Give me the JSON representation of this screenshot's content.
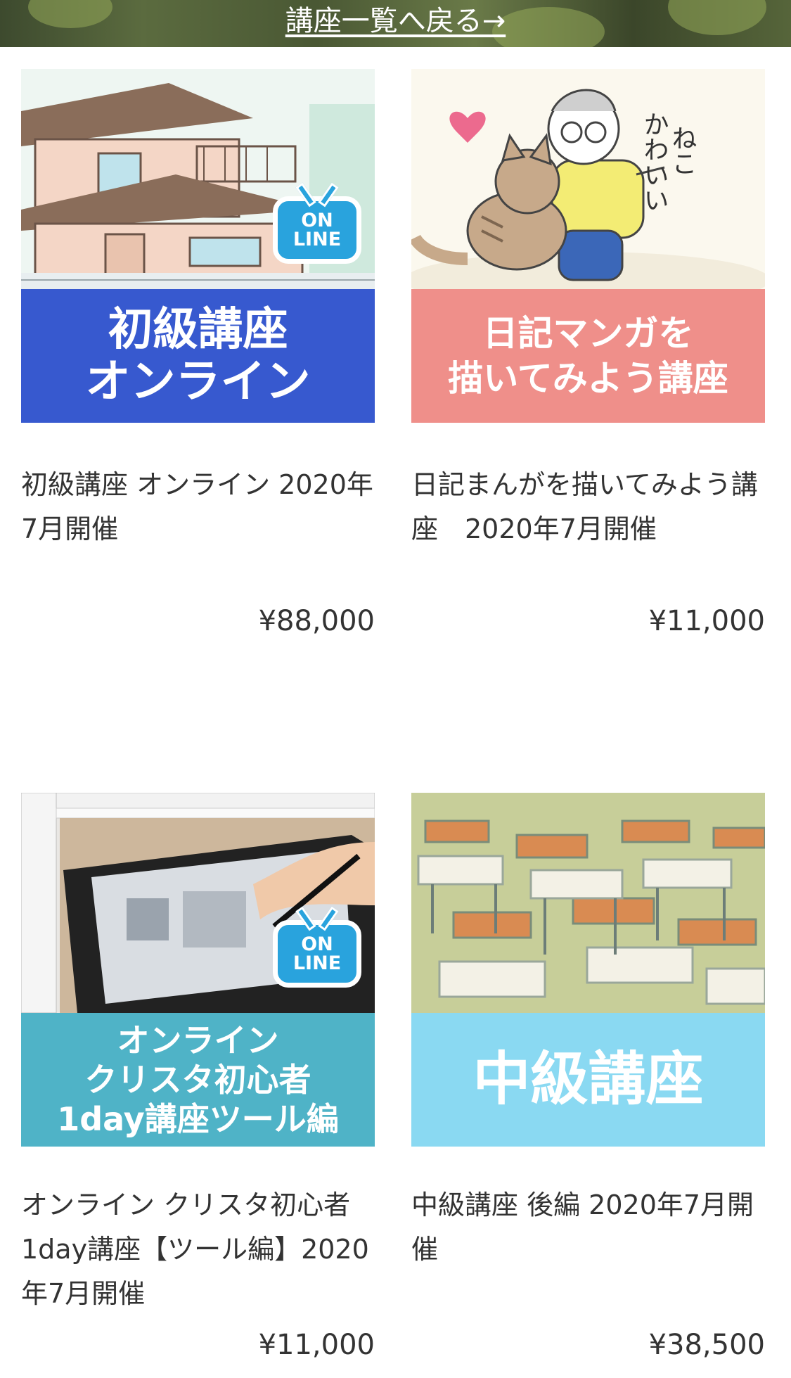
{
  "header": {
    "back_link": "講座一覧へ戻る→"
  },
  "products": [
    {
      "banner_lines": [
        "初級講座",
        "オンライン"
      ],
      "badge": [
        "ON",
        "LINE"
      ],
      "title": "初級講座 オンライン 2020年7月開催",
      "price": "¥88,000",
      "banner_color": "#3759cf"
    },
    {
      "banner_lines": [
        "日記マンガを",
        "描いてみよう講座"
      ],
      "art_text": "ねこ かわいい",
      "title": "日記まんがを描いてみよう講座　2020年7月開催",
      "price": "¥11,000",
      "banner_color": "#ef8f8a"
    },
    {
      "banner_lines": [
        "オンライン",
        "クリスタ初心者",
        "1day講座ツール編"
      ],
      "badge": [
        "ON",
        "LINE"
      ],
      "title": "オンライン クリスタ初心者1day講座【ツール編】2020年7月開催",
      "price": "¥11,000",
      "banner_color": "#4fb3c7"
    },
    {
      "banner_lines": [
        "中級講座"
      ],
      "title": "中級講座 後編 2020年7月開催",
      "price": "¥38,500",
      "banner_color": "#8ad9f2"
    }
  ]
}
